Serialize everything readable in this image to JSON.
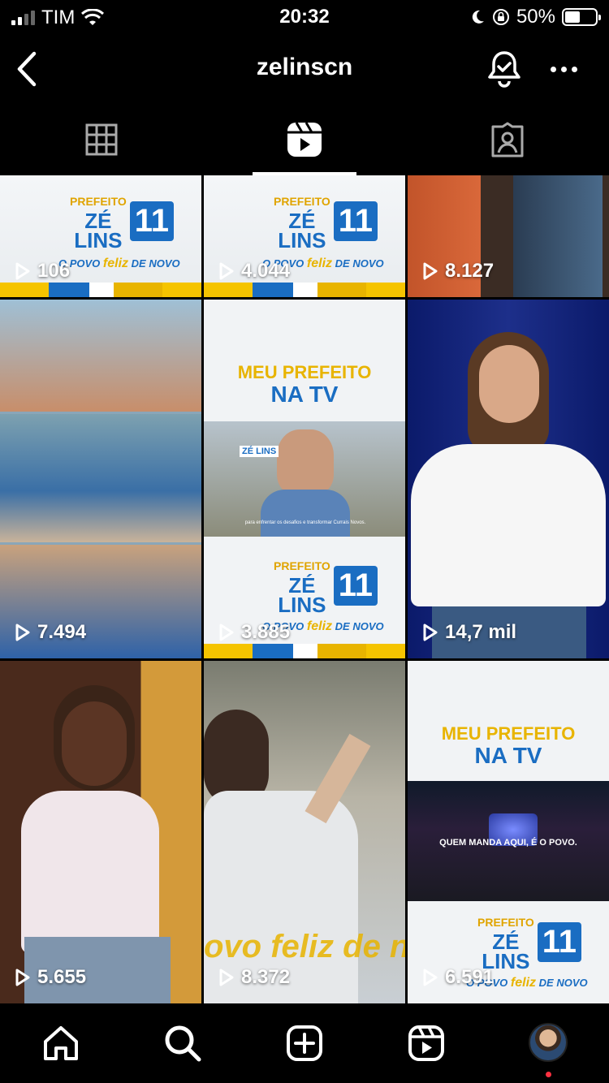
{
  "status_bar": {
    "carrier": "TIM",
    "time": "20:32",
    "battery": "50%",
    "battery_level": 0.5
  },
  "header": {
    "username": "zelinscn"
  },
  "tabs": [
    {
      "name": "grid",
      "icon": "grid-icon",
      "active": false
    },
    {
      "name": "reels",
      "icon": "reels-icon",
      "active": true
    },
    {
      "name": "tagged",
      "icon": "tagged-icon",
      "active": false
    }
  ],
  "reels": [
    {
      "views": "106",
      "kind": "brand"
    },
    {
      "views": "4.044",
      "kind": "brand"
    },
    {
      "views": "8.127",
      "kind": "photo-legs"
    },
    {
      "views": "7.494",
      "kind": "collage"
    },
    {
      "views": "3.885",
      "kind": "tv-promo"
    },
    {
      "views": "14,7 mil",
      "kind": "woman-portrait"
    },
    {
      "views": "5.655",
      "kind": "child-photo"
    },
    {
      "views": "8.372",
      "kind": "crowd-waving"
    },
    {
      "views": "6.591",
      "kind": "tv-promo-crowd"
    }
  ],
  "brand": {
    "logo_top": "ZÉ",
    "logo_bottom": "LINS",
    "logo_small": "PREFEITO",
    "number": "11",
    "slogan_pre": "O POVO",
    "slogan_mid": "feliz",
    "slogan_post": "DE NOVO"
  },
  "tv_promo": {
    "line1": "MEU PREFEITO",
    "line2": "NA TV",
    "crowd_caption": "QUEM MANDA AQUI, É O POVO.",
    "subtitle": "para enfrentar os desafios e transformar Currais Novos.",
    "small_logo": "ZÉ LINS"
  },
  "overlay_text": {
    "partial_slogan": "ovo feliz de no"
  },
  "colors": {
    "brand_blue": "#1a6dc2",
    "brand_yellow": "#e8b400",
    "background": "#000000",
    "notification_dot": "#ff3040"
  }
}
